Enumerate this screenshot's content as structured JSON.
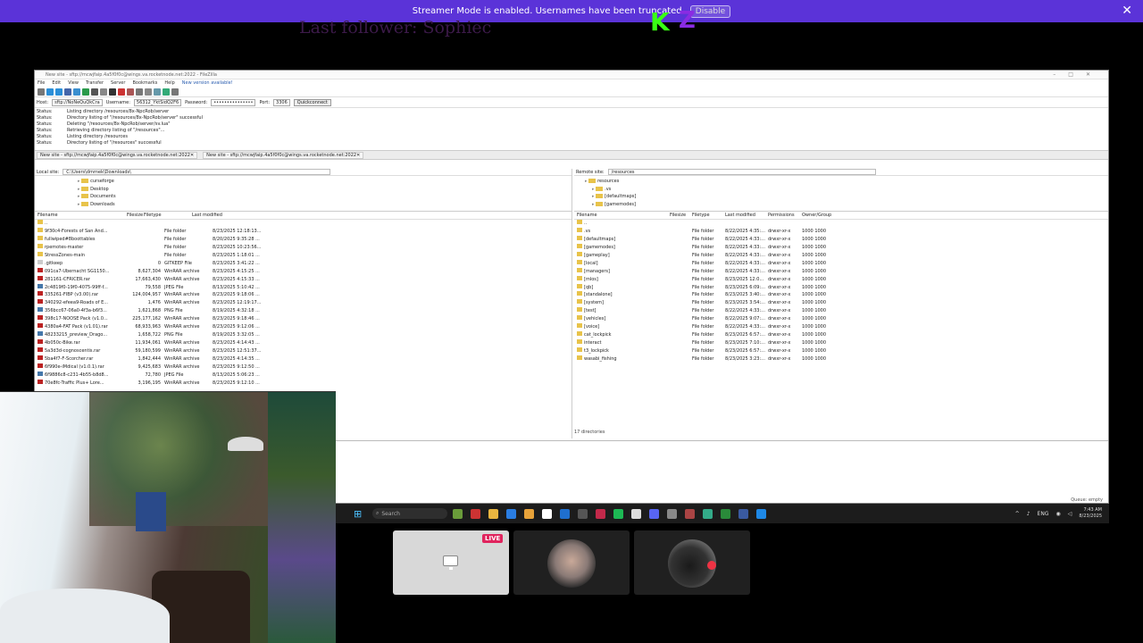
{
  "banner": {
    "message": "Streamer Mode is enabled. Usernames have been truncated.",
    "button": "Disable",
    "close": "✕"
  },
  "overlay": {
    "follower": "Last follower: Sophiec",
    "logo_k": "K",
    "logo_z": "Z"
  },
  "filezilla": {
    "title": "New site - sftp://mcwjfaip.4a5f0f0c@wings.va.rocketnode.net:2022 - FileZilla",
    "menu": [
      "File",
      "Edit",
      "View",
      "Transfer",
      "Server",
      "Bookmarks",
      "Help",
      "New version available!"
    ],
    "quickconnect": {
      "host_label": "Host:",
      "host_value": "sftp://NoNeQuQkCra",
      "username_label": "Username:",
      "username_value": "56312_YktSidQ2F6",
      "password_label": "Password:",
      "password_value": "•••••••••••••••",
      "port_label": "Port:",
      "port_value": "3306",
      "button": "Quickconnect"
    },
    "log": [
      {
        "label": "Status:",
        "text": "Listing directory /resources/8x-NpcRob/server"
      },
      {
        "label": "Status:",
        "text": "Directory listing of \"/resources/8x-NpcRob/server\" successful"
      },
      {
        "label": "Status:",
        "text": "Deleting \"/resources/8x-NpcRob/server/sv.lua\""
      },
      {
        "label": "Status:",
        "text": "Retrieving directory listing of \"/resources\"..."
      },
      {
        "label": "Status:",
        "text": "Listing directory /resources"
      },
      {
        "label": "Status:",
        "text": "Directory listing of \"/resources\" successful"
      }
    ],
    "tabs": [
      "New site - sftp://mcwjfaip.4a5f0f0c@wings.va.rocketnode.net:2022",
      "New site - sftp://mcwjfaip.4a5f0f0c@wings.va.rocketnode.net:2022"
    ],
    "local": {
      "site_label": "Local site:",
      "path": "C:\\Users\\dmrnek\\Downloads\\",
      "tree": [
        "curseforge",
        "Desktop",
        "Documents",
        "Downloads"
      ],
      "headers": [
        "Filename",
        "Filesize",
        "Filetype",
        "Last modified"
      ],
      "rows": [
        {
          "name": "..",
          "size": "",
          "type": "",
          "date": "",
          "icon": "folder"
        },
        {
          "name": "9f30c4-Forests of San And...",
          "size": "",
          "type": "File folder",
          "date": "8/23/2025 12:18:13...",
          "icon": "folder"
        },
        {
          "name": "fullwiped#8boottables",
          "size": "",
          "type": "File folder",
          "date": "8/20/2025 9:35:28 ...",
          "icon": "folder"
        },
        {
          "name": "rpemotes-master",
          "size": "",
          "type": "File folder",
          "date": "8/23/2025 10:23:56...",
          "icon": "folder"
        },
        {
          "name": "StressZones-main",
          "size": "",
          "type": "File folder",
          "date": "8/23/2025 1:18:01 ...",
          "icon": "folder"
        },
        {
          "name": ".gitkeep",
          "size": "0",
          "type": "GITKEEP File",
          "date": "8/23/2025 3:41:22 ...",
          "icon": "doc"
        },
        {
          "name": "091ca7-Ubernacht SG1150...",
          "size": "8,627,304",
          "type": "WinRAR archive",
          "date": "8/23/2025 4:15:25 ...",
          "icon": "rar"
        },
        {
          "name": "281161-CFRICER.rar",
          "size": "17,663,430",
          "type": "WinRAR archive",
          "date": "8/23/2025 4:15:33 ...",
          "icon": "rar"
        },
        {
          "name": "2c4819f0-19f0-4075-99ff-f...",
          "size": "79,558",
          "type": "JPEG File",
          "date": "8/13/2025 5:10:42 ...",
          "icon": "img"
        },
        {
          "name": "335261-FIBP (v3.00).rar",
          "size": "124,004,957",
          "type": "WinRAR archive",
          "date": "8/23/2025 9:18:06 ...",
          "icon": "rar"
        },
        {
          "name": "340292-efeea9-Roads of E...",
          "size": "1,476",
          "type": "WinRAR archive",
          "date": "8/23/2025 12:19:17...",
          "icon": "rar"
        },
        {
          "name": "356bcc67-06a0-4f3a-b6f3...",
          "size": "1,621,868",
          "type": "PNG File",
          "date": "8/19/2025 4:32:18 ...",
          "icon": "img"
        },
        {
          "name": "398c17-NOOSE Pack (v1.0...",
          "size": "225,177,162",
          "type": "WinRAR archive",
          "date": "8/23/2025 9:18:46 ...",
          "icon": "rar"
        },
        {
          "name": "4380a4-FAT Pack (v1.01).rar",
          "size": "68,933,963",
          "type": "WinRAR archive",
          "date": "8/23/2025 9:12:06 ...",
          "icon": "rar"
        },
        {
          "name": "48233215_preview_Drago...",
          "size": "1,658,722",
          "type": "PNG File",
          "date": "8/19/2025 3:32:05 ...",
          "icon": "img"
        },
        {
          "name": "4b050c-Bike.rar",
          "size": "11,934,061",
          "type": "WinRAR archive",
          "date": "8/23/2025 4:14:43 ...",
          "icon": "rar"
        },
        {
          "name": "5a3d3d-cognoscentis.rar",
          "size": "59,180,599",
          "type": "WinRAR archive",
          "date": "8/23/2025 12:51:37...",
          "icon": "rar"
        },
        {
          "name": "5ba4f7-F-Scorcher.rar",
          "size": "1,842,444",
          "type": "WinRAR archive",
          "date": "8/23/2025 4:14:35 ...",
          "icon": "rar"
        },
        {
          "name": "6f990e-iMdical (v1.0.1).rar",
          "size": "9,425,683",
          "type": "WinRAR archive",
          "date": "8/23/2025 9:12:50 ...",
          "icon": "rar"
        },
        {
          "name": "6f9886c8-c231-4b55-b8d8...",
          "size": "72,780",
          "type": "JPEG File",
          "date": "8/13/2025 5:06:23 ...",
          "icon": "img"
        },
        {
          "name": "70e8fc-Traffic Plus+ Lore...",
          "size": "3,196,195",
          "type": "WinRAR archive",
          "date": "8/23/2025 9:12:10 ...",
          "icon": "rar"
        }
      ]
    },
    "remote": {
      "site_label": "Remote site:",
      "path": "/resources",
      "tree": [
        "resources",
        ".vs",
        "[defaultmaps]",
        "[gamemodes]"
      ],
      "headers": [
        "Filename",
        "Filesize",
        "Filetype",
        "Last modified",
        "Permissions",
        "Owner/Group"
      ],
      "rows": [
        {
          "name": "..",
          "type": "",
          "date": "",
          "perm": "",
          "owner": ""
        },
        {
          "name": ".vs",
          "type": "File folder",
          "date": "8/22/2025 4:35:...",
          "perm": "drwxr-xr-x",
          "owner": "1000 1000"
        },
        {
          "name": "[defaultmaps]",
          "type": "File folder",
          "date": "8/22/2025 4:33:...",
          "perm": "drwxr-xr-x",
          "owner": "1000 1000"
        },
        {
          "name": "[gamemodes]",
          "type": "File folder",
          "date": "8/22/2025 4:33:...",
          "perm": "drwxr-xr-x",
          "owner": "1000 1000"
        },
        {
          "name": "[gameplay]",
          "type": "File folder",
          "date": "8/22/2025 4:33:...",
          "perm": "drwxr-xr-x",
          "owner": "1000 1000"
        },
        {
          "name": "[local]",
          "type": "File folder",
          "date": "8/22/2025 4:33:...",
          "perm": "drwxr-xr-x",
          "owner": "1000 1000"
        },
        {
          "name": "[managers]",
          "type": "File folder",
          "date": "8/22/2025 4:33:...",
          "perm": "drwxr-xr-x",
          "owner": "1000 1000"
        },
        {
          "name": "[mlos]",
          "type": "File folder",
          "date": "8/23/2025 12:0...",
          "perm": "drwxr-xr-x",
          "owner": "1000 1000"
        },
        {
          "name": "[qb]",
          "type": "File folder",
          "date": "8/23/2025 6:09:...",
          "perm": "drwxr-xr-x",
          "owner": "1000 1000"
        },
        {
          "name": "[standalone]",
          "type": "File folder",
          "date": "8/23/2025 3:40:...",
          "perm": "drwxr-xr-x",
          "owner": "1000 1000"
        },
        {
          "name": "[system]",
          "type": "File folder",
          "date": "8/23/2025 3:54:...",
          "perm": "drwxr-xr-x",
          "owner": "1000 1000"
        },
        {
          "name": "[test]",
          "type": "File folder",
          "date": "8/22/2025 4:33:...",
          "perm": "drwxr-xr-x",
          "owner": "1000 1000"
        },
        {
          "name": "[vehicles]",
          "type": "File folder",
          "date": "8/22/2025 9:07:...",
          "perm": "drwxr-xr-x",
          "owner": "1000 1000"
        },
        {
          "name": "[voice]",
          "type": "File folder",
          "date": "8/22/2025 4:33:...",
          "perm": "drwxr-xr-x",
          "owner": "1000 1000"
        },
        {
          "name": "cat_lockpick",
          "type": "File folder",
          "date": "8/23/2025 6:57:...",
          "perm": "drwxr-xr-x",
          "owner": "1000 1000"
        },
        {
          "name": "interact",
          "type": "File folder",
          "date": "8/23/2025 7:10:...",
          "perm": "drwxr-xr-x",
          "owner": "1000 1000"
        },
        {
          "name": "t3_lockpick",
          "type": "File folder",
          "date": "8/23/2025 6:57:...",
          "perm": "drwxr-xr-x",
          "owner": "1000 1000"
        },
        {
          "name": "wasabi_fishing",
          "type": "File folder",
          "date": "8/23/2025 3:23:...",
          "perm": "drwxr-xr-x",
          "owner": "1000 1000"
        }
      ],
      "status": "17 directories"
    },
    "queue_status": "Queue: empty"
  },
  "taskbar": {
    "search": "Search",
    "lang": "ENG",
    "time": "7:43 AM",
    "date": "8/23/2025"
  },
  "call": {
    "live": "LIVE"
  },
  "colors": {
    "banner": "#5b33d8",
    "live": "#e0245e",
    "logo_k": "#39ff14",
    "logo_z": "#8a2be2"
  }
}
